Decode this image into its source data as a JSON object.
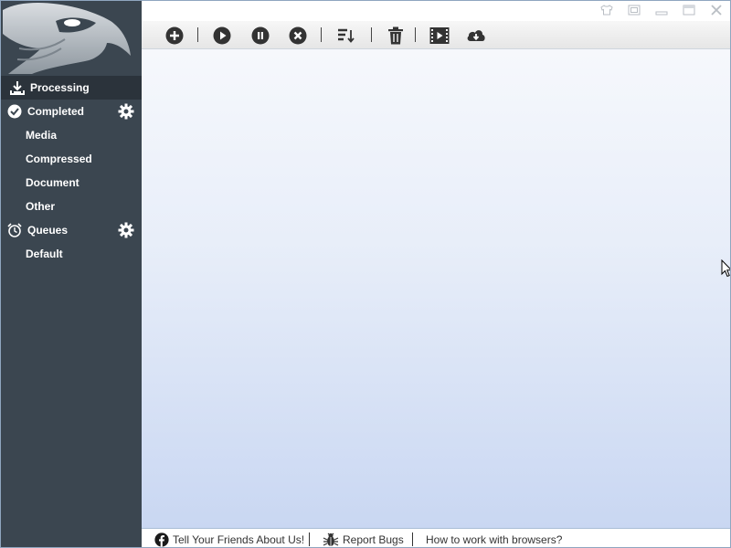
{
  "sidebar": {
    "items": [
      {
        "label": "Processing",
        "icon": "download-tray-icon",
        "active": true
      },
      {
        "label": "Completed",
        "icon": "check-circle-icon",
        "settings": "gear-icon"
      },
      {
        "label": "Media"
      },
      {
        "label": "Compressed"
      },
      {
        "label": "Document"
      },
      {
        "label": "Other"
      },
      {
        "label": "Queues",
        "icon": "alarm-clock-icon",
        "settings": "gear-icon"
      },
      {
        "label": "Default"
      }
    ]
  },
  "toolbar": {
    "buttons": [
      "add-icon",
      "play-icon",
      "pause-icon",
      "stop-icon",
      "sort-icon",
      "trash-icon",
      "video-icon",
      "cloud-download-icon"
    ]
  },
  "window_controls": [
    "shirt-icon",
    "restore-icon",
    "minimize-icon",
    "maximize-icon",
    "close-icon"
  ],
  "statusbar": {
    "tell_friends": "Tell Your Friends About Us!",
    "report_bugs": "Report Bugs",
    "browsers": "How to work with browsers?"
  },
  "colors": {
    "sidebar": "#3b4650",
    "sidebar_active": "#2b333b",
    "content_top": "#f6f8fc",
    "content_bottom": "#c9d7f2",
    "facebook": "#1a1a1a"
  }
}
